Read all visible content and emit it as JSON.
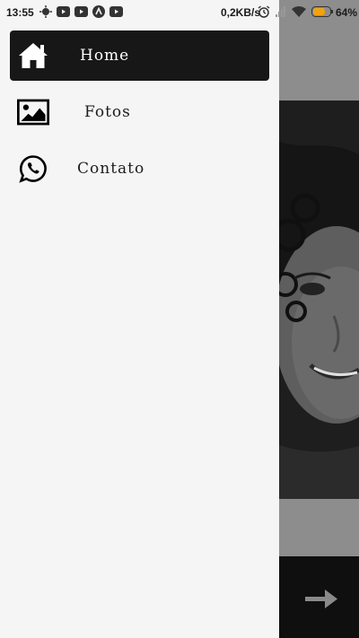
{
  "status_bar": {
    "time": "13:55",
    "network_speed": "0,2KB/s",
    "battery_percent": "64%",
    "left_icons": [
      "weather-icon",
      "youtube-icon",
      "youtube-icon",
      "app-icon",
      "youtube-icon"
    ],
    "right_icons": [
      "alarm-icon",
      "signal-icon",
      "wifi-icon",
      "battery-icon"
    ],
    "battery_color": "#f2a20f"
  },
  "drawer": {
    "background": "#f5f5f5",
    "active_color": "#171717",
    "items": [
      {
        "label": "Home",
        "icon": "home-icon",
        "active": true
      },
      {
        "label": "Fotos",
        "icon": "image-icon",
        "active": false
      },
      {
        "label": "Contato",
        "icon": "whatsapp-icon",
        "active": false
      }
    ]
  },
  "background_app": {
    "next_icon": "arrow-right-icon"
  }
}
